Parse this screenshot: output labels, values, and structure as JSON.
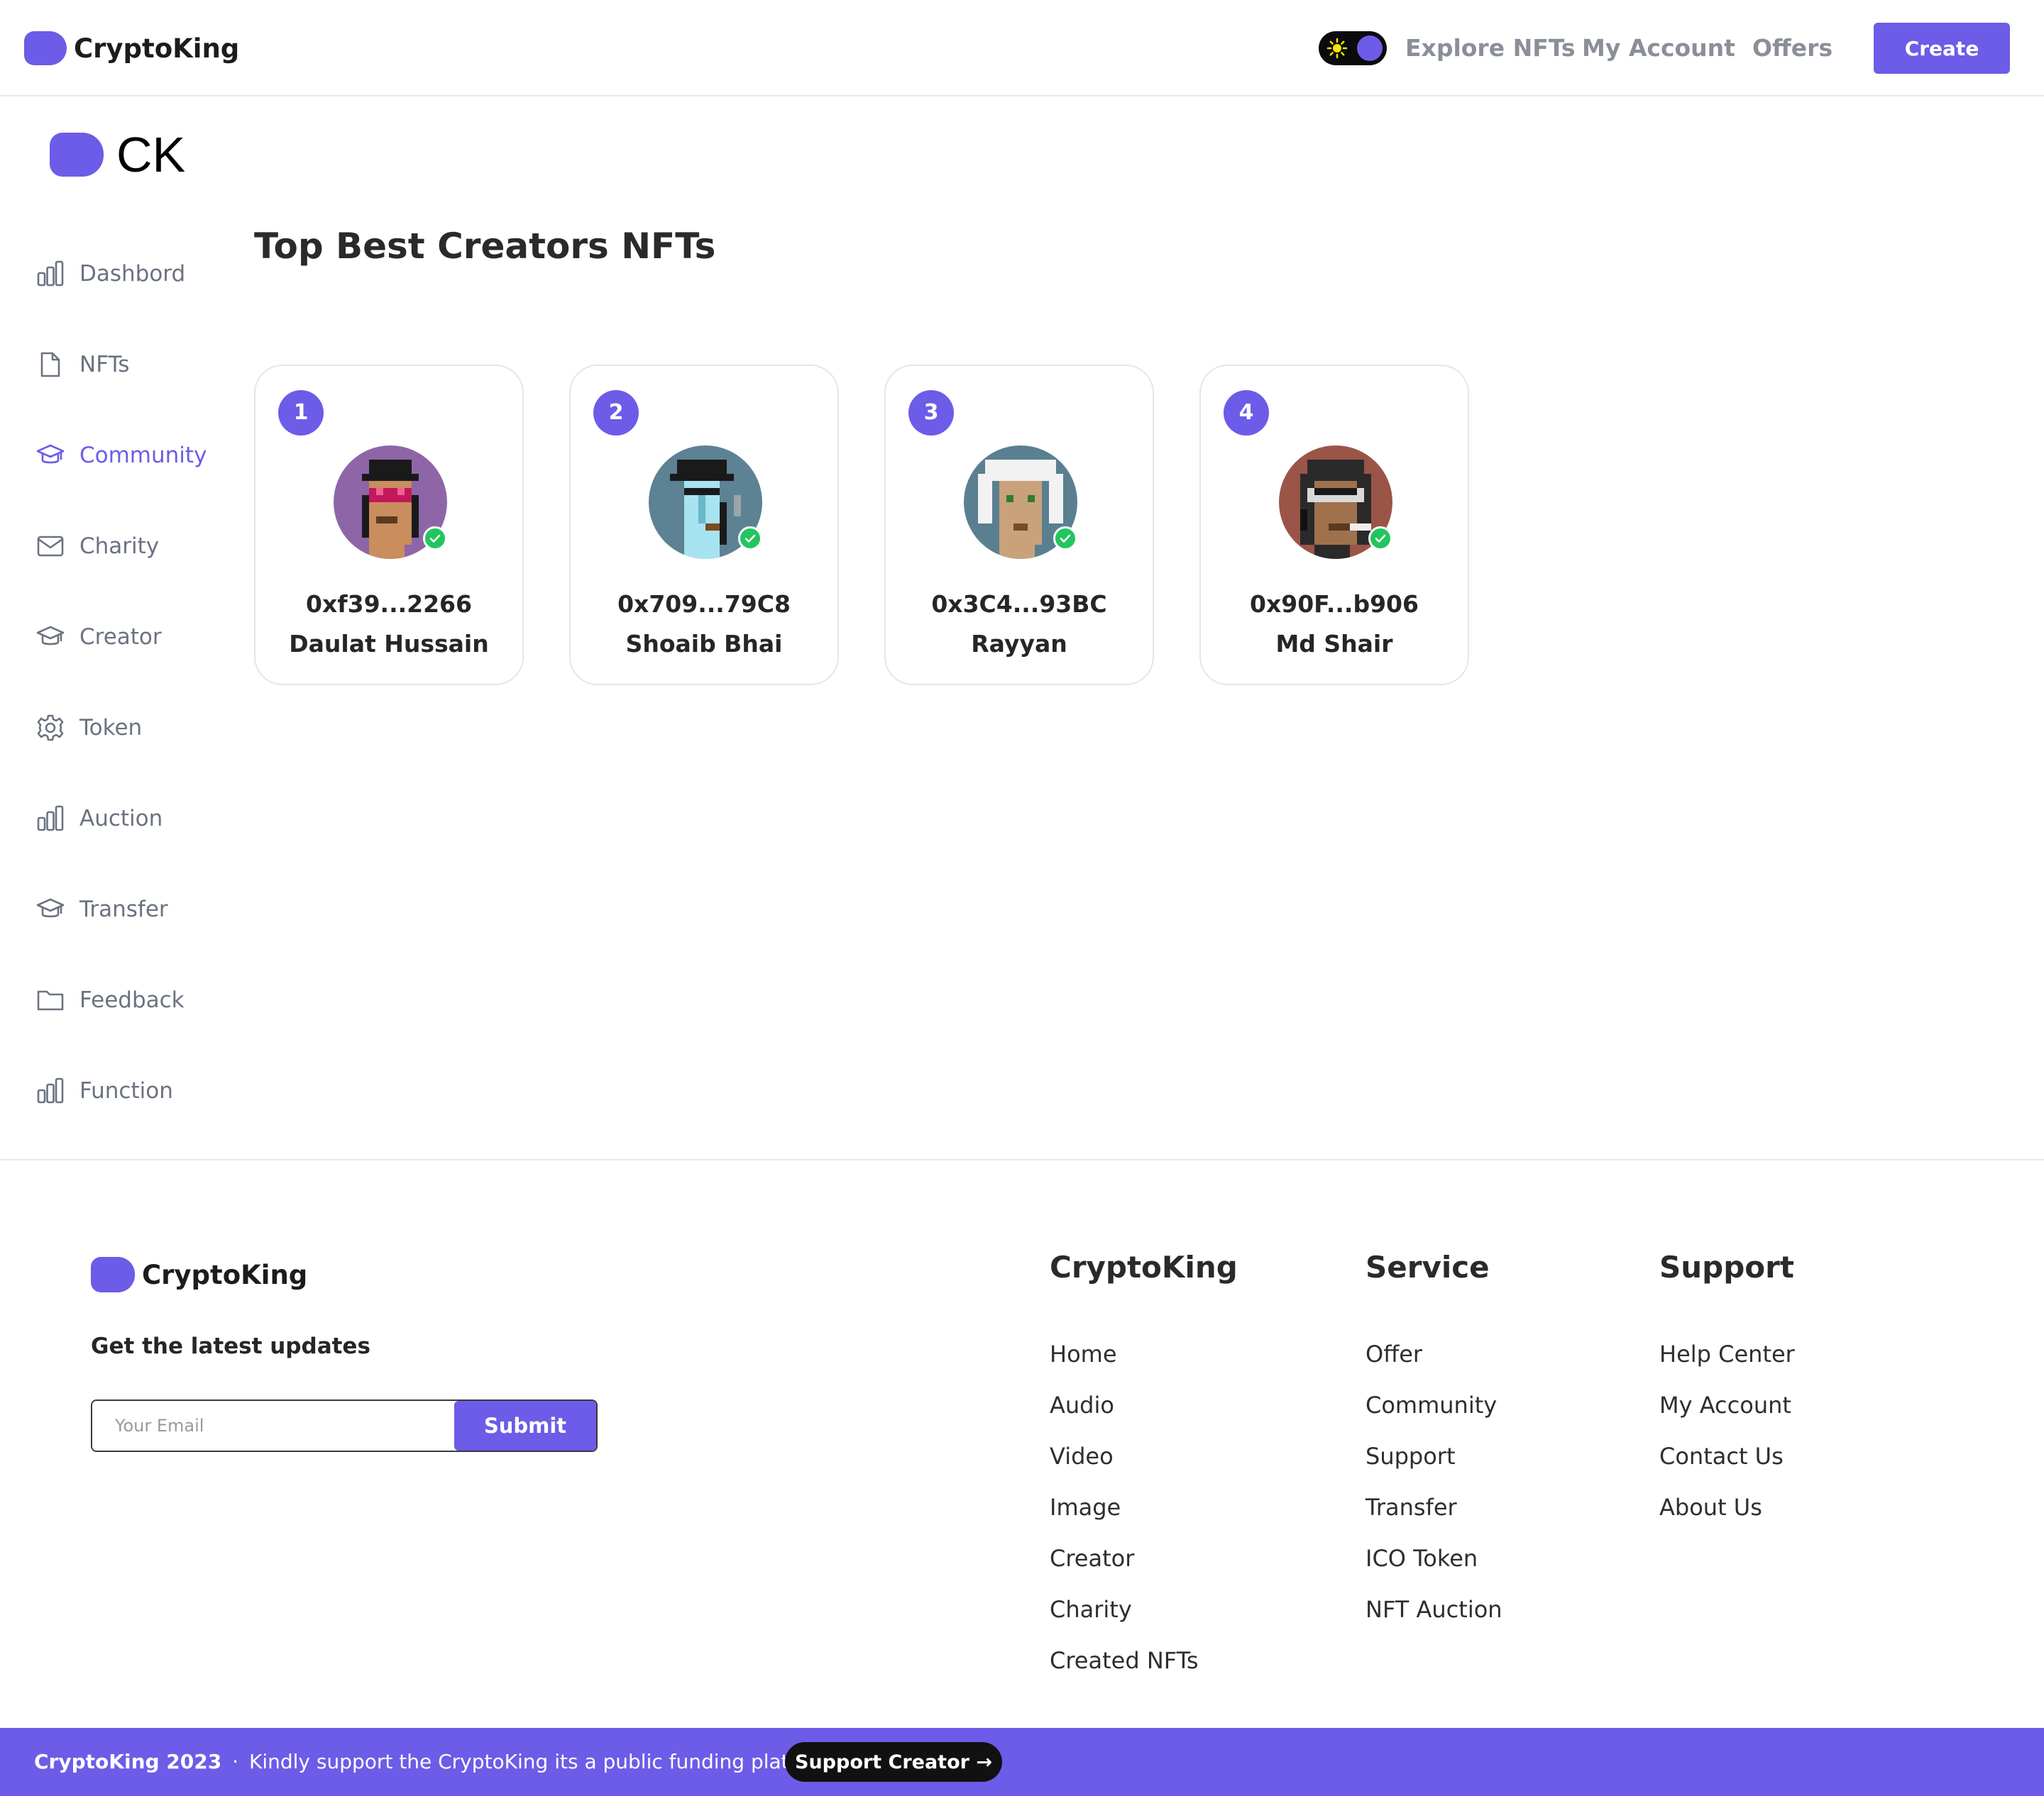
{
  "header": {
    "brand": "CryptoKing",
    "nav": [
      "Explore NFTs",
      "My Account",
      "Offers"
    ],
    "create_label": "Create",
    "theme_toggle": "sun-icon"
  },
  "sidebar": {
    "logo_text": "CK",
    "items": [
      {
        "label": "Dashbord",
        "icon": "bar-chart-icon"
      },
      {
        "label": "NFTs",
        "icon": "file-icon"
      },
      {
        "label": "Community",
        "icon": "graduation-cap-icon",
        "active": true
      },
      {
        "label": "Charity",
        "icon": "mail-icon"
      },
      {
        "label": "Creator",
        "icon": "graduation-cap-icon"
      },
      {
        "label": "Token",
        "icon": "gear-icon"
      },
      {
        "label": "Auction",
        "icon": "bar-chart-icon"
      },
      {
        "label": "Transfer",
        "icon": "graduation-cap-icon"
      },
      {
        "label": "Feedback",
        "icon": "folder-icon"
      },
      {
        "label": "Function",
        "icon": "bar-chart-icon"
      }
    ]
  },
  "main": {
    "title": "Top Best Creators NFTs",
    "creators": [
      {
        "rank": "1",
        "address": "0xf39...2266",
        "name": "Daulat Hussain"
      },
      {
        "rank": "2",
        "address": "0x709...79C8",
        "name": "Shoaib Bhai"
      },
      {
        "rank": "3",
        "address": "0x3C4...93BC",
        "name": "Rayyan"
      },
      {
        "rank": "4",
        "address": "0x90F...b906",
        "name": "Md Shair"
      }
    ]
  },
  "footer": {
    "brand": "CryptoKing",
    "updates_title": "Get the latest updates",
    "email_placeholder": "Your Email",
    "submit_label": "Submit",
    "columns": [
      {
        "title": "CryptoKing",
        "links": [
          "Home",
          "Audio",
          "Video",
          "Image",
          "Creator",
          "Charity",
          "Created NFTs"
        ]
      },
      {
        "title": "Service",
        "links": [
          "Offer",
          "Community",
          "Support",
          "Transfer",
          "ICO Token",
          "NFT Auction"
        ]
      },
      {
        "title": "Support",
        "links": [
          "Help Center",
          "My Account",
          "Contact Us",
          "About Us"
        ]
      }
    ]
  },
  "bottom_bar": {
    "year_text": "CryptoKing 2023",
    "separator": "·",
    "message": "Kindly support the CryptoKing its a public funding platform",
    "button_label": "Support Creator →"
  },
  "colors": {
    "accent": "#6c5ce7",
    "verified": "#22c55e",
    "muted_text": "#6b7280"
  }
}
